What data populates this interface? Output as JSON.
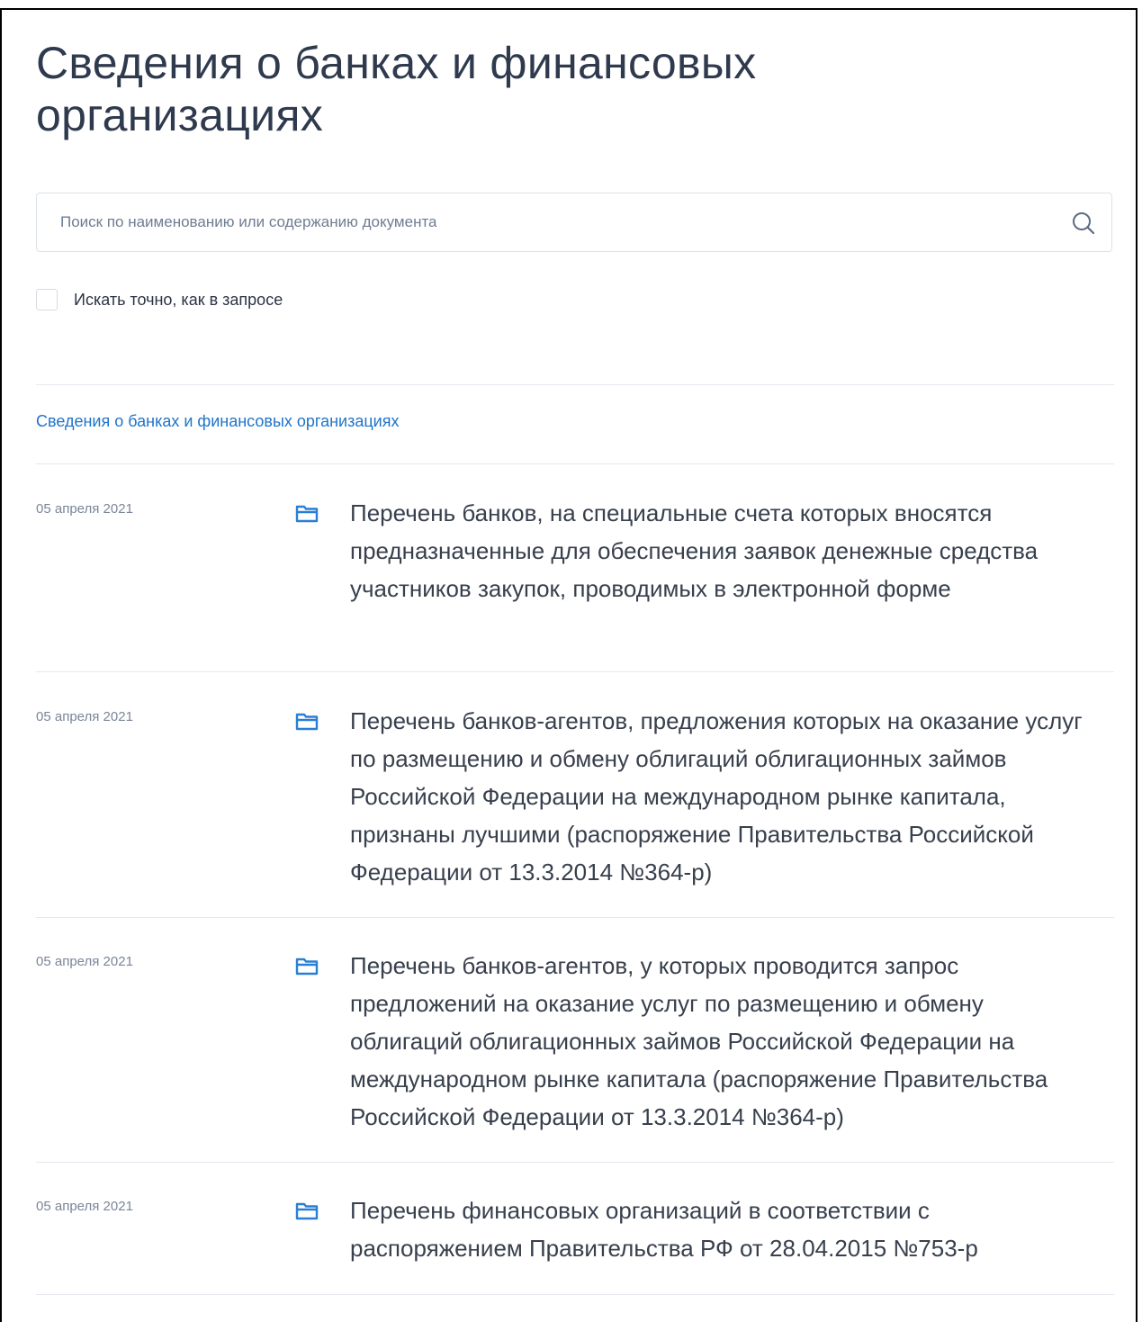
{
  "page": {
    "title": "Сведения о банках и финансовых организациях"
  },
  "search": {
    "placeholder": "Поиск по наименованию или содержанию документа",
    "value": "",
    "icon": "search-icon"
  },
  "exact_search": {
    "label": "Искать точно, как в запросе",
    "checked": false
  },
  "breadcrumb": {
    "label": "Сведения о банках и финансовых организациях"
  },
  "documents": [
    {
      "date": "05 апреля 2021",
      "icon": "folder-icon",
      "title": "Перечень банков, на специальные счета которых вносятся предназначенные для обеспечения заявок денежные средства участников закупок, проводимых в электронной форме"
    },
    {
      "date": "05 апреля 2021",
      "icon": "folder-icon",
      "title": "Перечень банков-агентов, предложения которых на оказание услуг по размещению и обмену облигаций облигационных займов Российской Федерации на международном рынке капитала, признаны лучшими (распоряжение Правительства Российской Федерации от 13.3.2014 №364-р)"
    },
    {
      "date": "05 апреля 2021",
      "icon": "folder-icon",
      "title": "Перечень банков-агентов, у которых проводится запрос предложений на оказание услуг по размещению и обмену облигаций облигационных займов Российской Федерации на международном рынке капитала (распоряжение Правительства Российской Федерации от 13.3.2014 №364-р)"
    },
    {
      "date": "05 апреля 2021",
      "icon": "folder-icon",
      "title": "Перечень финансовых организаций в соответствии с распоряжением Правительства РФ от 28.04.2015 №753-р"
    }
  ],
  "colors": {
    "accent": "#1f74c9",
    "text": "#38404d",
    "muted": "#7a8699",
    "border": "#e4e8ee"
  }
}
